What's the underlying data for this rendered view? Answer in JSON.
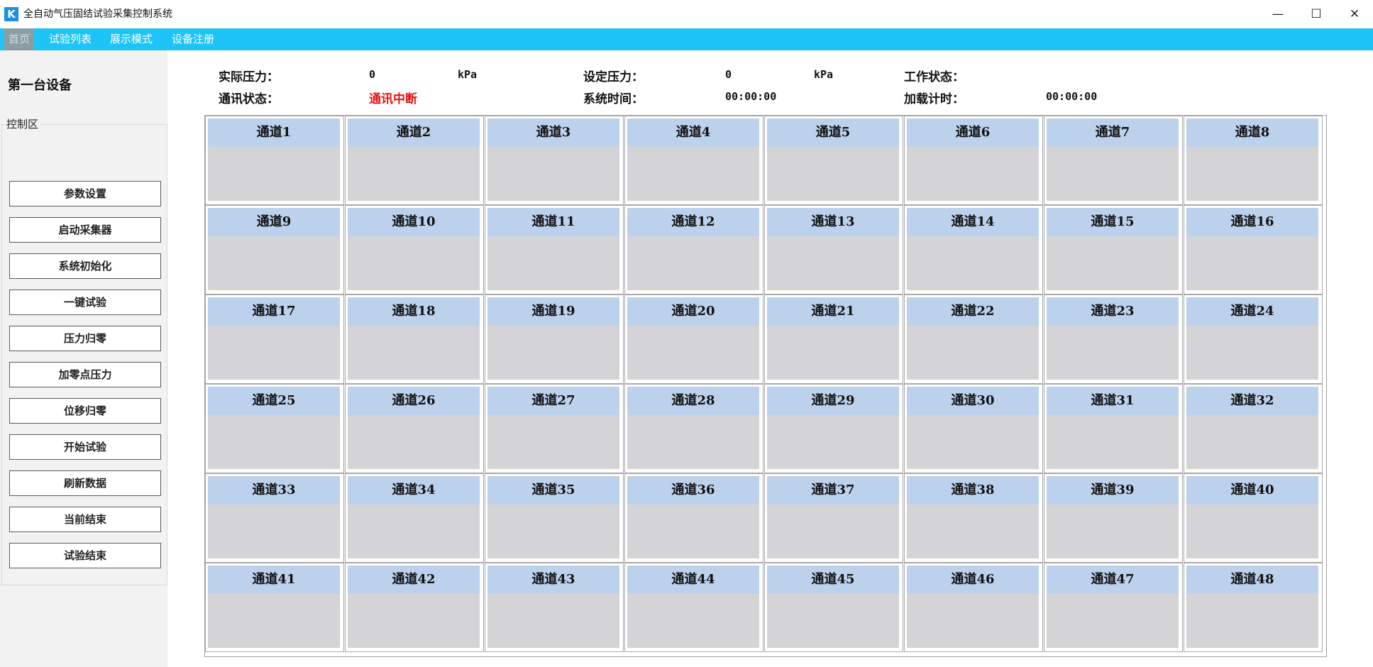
{
  "window": {
    "icon_letter": "K",
    "title": "全自动气压固结试验采集控制系统",
    "minimize": "—",
    "maximize": "☐",
    "close": "✕"
  },
  "menu": [
    "首页",
    "试验列表",
    "展示模式",
    "设备注册"
  ],
  "device_title": "第一台设备",
  "control_area": {
    "label": "控制区",
    "buttons": [
      "参数设置",
      "启动采集器",
      "系统初始化",
      "一键试验",
      "压力归零",
      "加零点压力",
      "位移归零",
      "开始试验",
      "刷新数据",
      "当前结束",
      "试验结束"
    ]
  },
  "status": {
    "actual_pressure_label": "实际压力：",
    "actual_pressure_value": "0",
    "actual_pressure_unit": "kPa",
    "set_pressure_label": "设定压力：",
    "set_pressure_value": "0",
    "set_pressure_unit": "kPa",
    "work_state_label": "工作状态：",
    "comm_state_label": "通讯状态：",
    "comm_state_value": "通讯中断",
    "system_time_label": "系统时间：",
    "system_time_value": "00:00:00",
    "load_timer_label": "加载计时：",
    "load_timer_value": "00:00:00"
  },
  "channels": [
    "通道1",
    "通道2",
    "通道3",
    "通道4",
    "通道5",
    "通道6",
    "通道7",
    "通道8",
    "通道9",
    "通道10",
    "通道11",
    "通道12",
    "通道13",
    "通道14",
    "通道15",
    "通道16",
    "通道17",
    "通道18",
    "通道19",
    "通道20",
    "通道21",
    "通道22",
    "通道23",
    "通道24",
    "通道25",
    "通道26",
    "通道27",
    "通道28",
    "通道29",
    "通道30",
    "通道31",
    "通道32",
    "通道33",
    "通道34",
    "通道35",
    "通道36",
    "通道37",
    "通道38",
    "通道39",
    "通道40",
    "通道41",
    "通道42",
    "通道43",
    "通道44",
    "通道45",
    "通道46",
    "通道47",
    "通道48"
  ]
}
